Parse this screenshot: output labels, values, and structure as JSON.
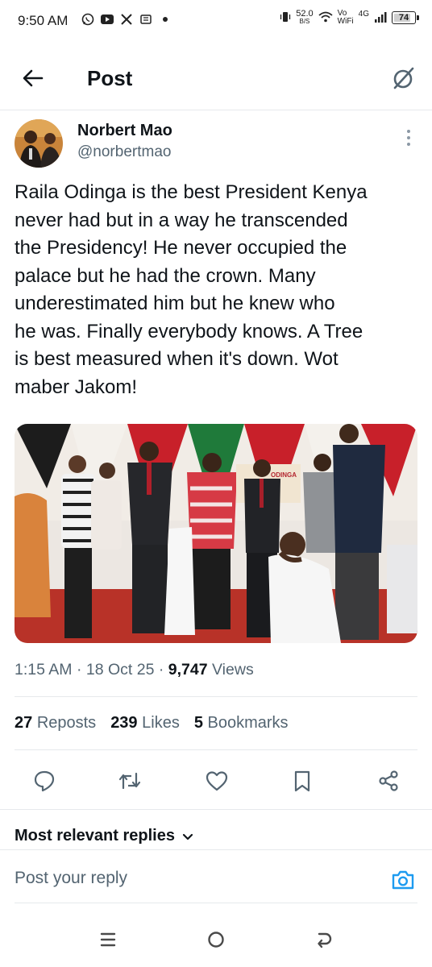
{
  "status_bar": {
    "time": "9:50 AM",
    "left_icons": [
      "whatsapp-icon",
      "youtube-icon",
      "x-icon",
      "news-icon",
      "dot-icon"
    ],
    "speed_value": "52.0",
    "speed_unit": "B/S",
    "vo_label": "Vo",
    "wifi_label": "WiFi",
    "network": "4G",
    "battery": "74"
  },
  "header": {
    "title": "Post"
  },
  "author": {
    "name": "Norbert Mao",
    "handle": "@norbertmao"
  },
  "post": {
    "text_lines": [
      "Raila Odinga is the best President Kenya",
      "never had but in a way he transcended",
      "the Presidency! He never occupied the",
      "palace but he had the crown. Many",
      "underestimated him but he knew who",
      "he was. Finally everybody knows. A Tree",
      "is best measured when it's down. Wot",
      "maber Jakom!"
    ],
    "image_banner_text": "ODINGA"
  },
  "meta": {
    "time": "1:15 AM",
    "separator": "·",
    "date": "18 Oct 25",
    "views_count": "9,747",
    "views_label": "Views"
  },
  "stats": {
    "reposts_count": "27",
    "reposts_label": "Reposts",
    "likes_count": "239",
    "likes_label": "Likes",
    "bookmarks_count": "5",
    "bookmarks_label": "Bookmarks"
  },
  "actions": [
    "reply-icon",
    "repost-icon",
    "like-icon",
    "bookmark-icon",
    "share-icon"
  ],
  "replies": {
    "filter_label": "Most relevant replies",
    "input_placeholder": "Post your reply"
  },
  "colors": {
    "text_primary": "#0f1419",
    "text_secondary": "#536471",
    "accent": "#1d9bf0",
    "divider": "#e6e9ec"
  }
}
